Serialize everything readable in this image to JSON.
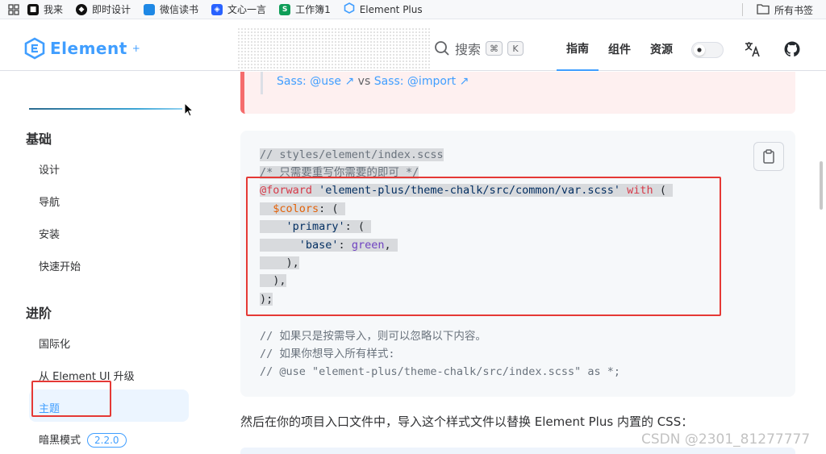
{
  "bookmarks": {
    "items": [
      {
        "label": "我来",
        "icon": "wolai-icon",
        "color": "#111111"
      },
      {
        "label": "即时设计",
        "icon": "jsdesign-icon",
        "color": "#111111"
      },
      {
        "label": "微信读书",
        "icon": "weread-icon",
        "color": "#1e88e5"
      },
      {
        "label": "文心一言",
        "icon": "yiyan-icon",
        "color": "#2962ff"
      },
      {
        "label": "工作簿1",
        "icon": "sheet-icon",
        "color": "#0f9d58"
      },
      {
        "label": "Element Plus",
        "icon": "element-plus-icon",
        "color": "#409eff"
      }
    ],
    "all_label": "所有书签"
  },
  "header": {
    "logo_text": "Element",
    "logo_sup": "+",
    "search_label": "搜索",
    "kbd_cmd": "⌘",
    "kbd_k": "K",
    "nav": [
      {
        "label": "指南",
        "active": true
      },
      {
        "label": "组件",
        "active": false
      },
      {
        "label": "资源",
        "active": false
      }
    ]
  },
  "sidebar": {
    "group_basic": "基础",
    "basic_items": [
      "设计",
      "导航",
      "安装",
      "快速开始"
    ],
    "group_advanced": "进阶",
    "advanced_items": [
      "国际化",
      "从 Element UI 升级",
      "主题",
      "暗黑模式"
    ],
    "dark_badge": "2.2.0",
    "active_item": "主题"
  },
  "tip": {
    "link1": "Sass: @use",
    "vs": "vs",
    "link2": "Sass: @import"
  },
  "code": {
    "lines": [
      "// styles/element/index.scss",
      "/* 只需要重写你需要的即可 */",
      "@forward",
      " 'element-plus/theme-chalk/src/common/var.scss'",
      " with",
      " (",
      "  $colors",
      ": (",
      "    'primary'",
      ": (",
      "      'base'",
      ": ",
      "green",
      ",",
      "    ),",
      "  ),",
      ");",
      "// 如果只是按需导入，则可以忽略以下内容。",
      "// 如果你想导入所有样式:",
      "// @use \"element-plus/theme-chalk/src/index.scss\" as *;"
    ]
  },
  "paragraph": "然后在你的项目入口文件中，导入这个样式文件以替换 Element Plus 内置的 CSS：",
  "watermark": "CSDN @2301_81277777",
  "colors": {
    "accent": "#409eff",
    "highlight_box": "#e53935"
  }
}
